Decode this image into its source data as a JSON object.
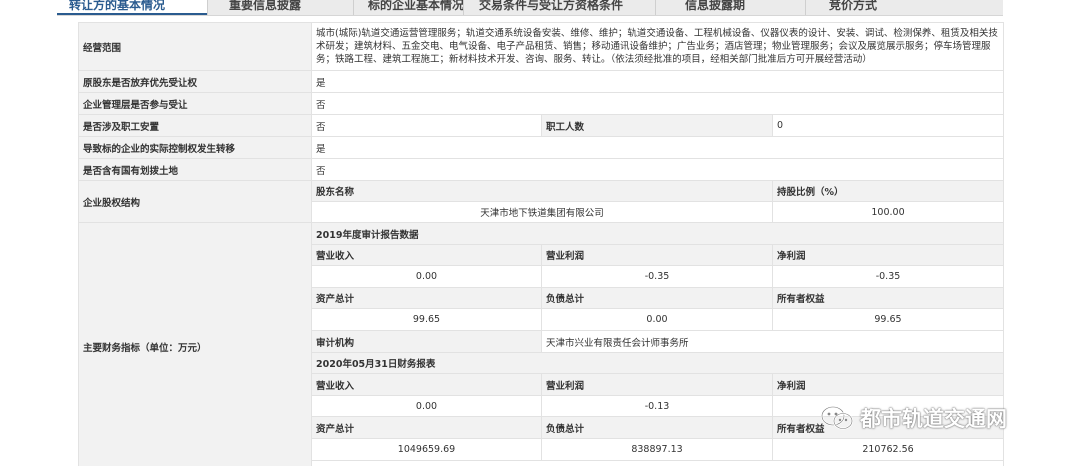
{
  "tabs": [
    {
      "label": "转让方的基本情况",
      "active": true
    },
    {
      "label": "重要信息披露",
      "active": false
    },
    {
      "label": "标的企业基本情况",
      "active": false
    },
    {
      "label": "交易条件与受让方资格条件",
      "active": false
    },
    {
      "label": "信息披露期",
      "active": false
    },
    {
      "label": "竞价方式",
      "active": false
    }
  ],
  "top_stub": "",
  "rows": {
    "scope": {
      "label": "经营范围",
      "value": "城市(城际)轨道交通运营管理服务；轨道交通系统设备安装、维修、维护；轨道交通设备、工程机械设备、仪器仪表的设计、安装、调试、检测保养、租赁及相关技术研发；建筑材料、五金交电、电气设备、电子产品租赁、销售；移动通讯设备维护；广告业务；酒店管理；物业管理服务；会议及展览展示服务；停车场管理服务；铁路工程、建筑工程施工；新材料技术开发、咨询、服务、转让。（依法须经批准的项目，经相关部门批准后方可开展经营活动）"
    },
    "waive": {
      "label": "原股东是否放弃优先受让权",
      "value": "是"
    },
    "mgmt": {
      "label": "企业管理层是否参与受让",
      "value": "否"
    },
    "staff": {
      "label": "是否涉及职工安置",
      "value": "否",
      "label2": "职工人数",
      "value2": "0"
    },
    "control": {
      "label": "导致标的企业的实际控制权发生转移",
      "value": "是"
    },
    "land": {
      "label": "是否含有国有划拨土地",
      "value": "否"
    },
    "equity": {
      "label": "企业股权结构",
      "h_name": "股东名称",
      "h_ratio": "持股比例（%）",
      "name": "天津市地下铁道集团有限公司",
      "ratio": "100.00"
    },
    "finance": {
      "label": "主要财务指标（单位：万元）",
      "audit_title": "2019年度审计报告数据",
      "h_revenue": "营业收入",
      "h_profit": "营业利润",
      "h_net": "净利润",
      "revenue": "0.00",
      "profit": "-0.35",
      "net": "-0.35",
      "h_assets": "资产总计",
      "h_liab": "负债总计",
      "h_equity": "所有者权益",
      "assets": "99.65",
      "liab": "0.00",
      "equity": "99.65",
      "h_auditor": "审计机构",
      "auditor": "天津市兴业有限责任会计师事务所",
      "report_title": "2020年05月31日财务报表",
      "h_revenue2": "营业收入",
      "h_profit2": "营业利润",
      "h_net2": "净利润",
      "revenue2": "0.00",
      "profit2": "-0.13",
      "net2": "",
      "h_assets2": "资产总计",
      "h_liab2": "负债总计",
      "h_equity2": "所有者权益",
      "assets2": "1049659.69",
      "liab2": "838897.13",
      "equity2": "210762.56"
    }
  },
  "watermark": {
    "text": "都市轨道交通网",
    "icon": "wechat-icon"
  }
}
